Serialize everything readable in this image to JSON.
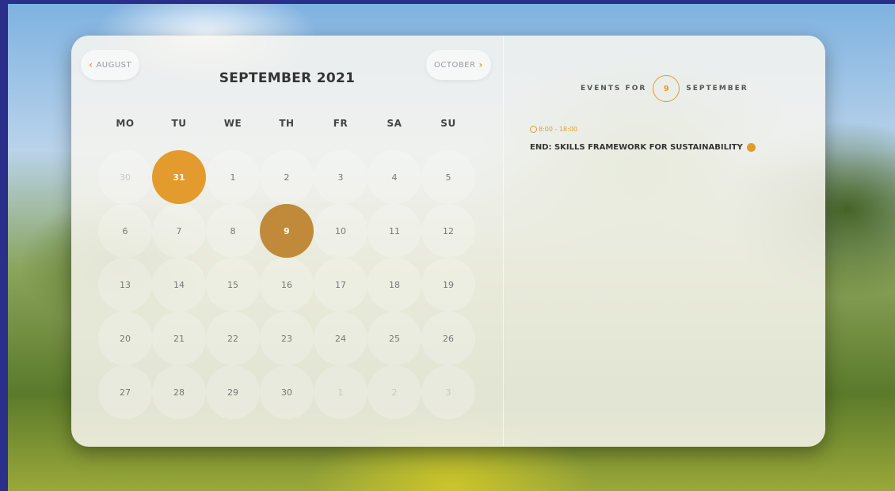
{
  "calendar": {
    "prev_label": "AUGUST",
    "next_label": "OCTOBER",
    "title": "SEPTEMBER 2021",
    "weekdays": [
      "MO",
      "TU",
      "WE",
      "TH",
      "FR",
      "SA",
      "SU"
    ],
    "weeks": [
      [
        "30",
        "31",
        "1",
        "2",
        "3",
        "4",
        "5"
      ],
      [
        "6",
        "7",
        "8",
        "9",
        "10",
        "11",
        "12"
      ],
      [
        "13",
        "14",
        "15",
        "16",
        "17",
        "18",
        "19"
      ],
      [
        "20",
        "21",
        "22",
        "23",
        "24",
        "25",
        "26"
      ],
      [
        "27",
        "28",
        "29",
        "30",
        "1",
        "2",
        "3"
      ]
    ],
    "today_value": "31",
    "selected_value": "9"
  },
  "events": {
    "prefix": "EVENTS FOR",
    "day": "9",
    "month": "SEPTEMBER",
    "items": [
      {
        "time": "8:00 - 18:00",
        "title": "END: SKILLS FRAMEWORK FOR SUSTAINABILITY"
      }
    ]
  },
  "colors": {
    "accent": "#e39b2d",
    "selected": "#c08a3a"
  },
  "icons": {
    "prev": "chevron-left-icon",
    "next": "chevron-right-icon",
    "time": "clock-icon",
    "event": "event-dot-icon"
  }
}
